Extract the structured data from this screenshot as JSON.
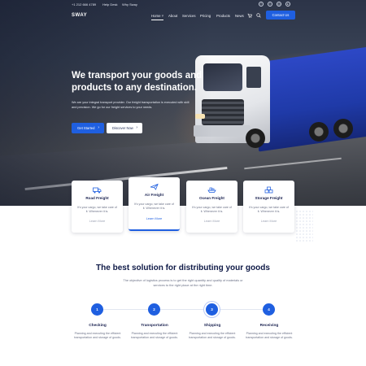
{
  "topbar": {
    "phone": "+1 212 666 4789",
    "help": "Help Desk",
    "why": "Why Sway",
    "social_icons": [
      "facebook-icon",
      "twitter-icon",
      "instagram-icon",
      "youtube-icon"
    ]
  },
  "navbar": {
    "logo": "SWAY",
    "items": [
      {
        "label": "Home ˅",
        "active": true
      },
      {
        "label": "About"
      },
      {
        "label": "Services"
      },
      {
        "label": "Pricing"
      },
      {
        "label": "Products"
      },
      {
        "label": "News"
      }
    ],
    "cart_icon": "cart-icon",
    "search_icon": "search-icon",
    "contact_label": "Contact Us"
  },
  "hero": {
    "title": "We transport your goods and products to any destination.",
    "description": "We are your integral transport provider. Our freight transportation is executed with skill and precision. We go for our freight services to your needs.",
    "primary_label": "Get Started",
    "secondary_label": "Discover Now"
  },
  "services": [
    {
      "title": "Road Freight",
      "text": "It's your cargo, we take care of it. Whenever it is.",
      "link": "Learn More",
      "icon": "road-freight-icon"
    },
    {
      "title": "Air Freight",
      "text": "It's your cargo, we take care of it. Whenever it is.",
      "link": "Learn More",
      "icon": "air-freight-icon"
    },
    {
      "title": "Ocean Freight",
      "text": "It's your cargo, we take care of it. Whenever it is.",
      "link": "Learn More",
      "icon": "ocean-freight-icon"
    },
    {
      "title": "Storage Freight",
      "text": "It's your cargo, we take care of it. Whenever it is.",
      "link": "Learn More",
      "icon": "storage-freight-icon"
    }
  ],
  "solution": {
    "title": "The best solution for distributing your goods",
    "description": "The objective of logistics process is to get the right quantity and quality of materials or services to the right place at the right time.",
    "steps": [
      {
        "number": "1",
        "title": "Checking",
        "text": "Planning and executing the efficient transportation and storage of goods."
      },
      {
        "number": "2",
        "title": "Transportation",
        "text": "Planning and executing the efficient transportation and storage of goods."
      },
      {
        "number": "3",
        "title": "Shipping",
        "text": "Planning and executing the efficient transportation and storage of goods."
      },
      {
        "number": "4",
        "title": "Receiving",
        "text": "Planning and executing the efficient transportation and storage of goods."
      }
    ]
  },
  "colors": {
    "accent": "#1f5fe0",
    "heading": "#0f1a47",
    "muted": "#6b7186"
  }
}
